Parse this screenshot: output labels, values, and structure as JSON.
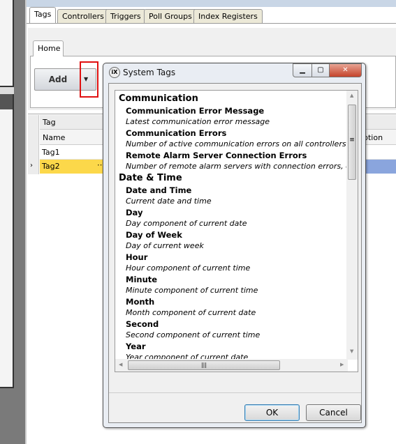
{
  "main_tabs": [
    {
      "label": "Tags",
      "active": true
    },
    {
      "label": "Controllers"
    },
    {
      "label": "Triggers"
    },
    {
      "label": "Poll Groups"
    },
    {
      "label": "Index Registers"
    }
  ],
  "ribbon": {
    "tab": "Home",
    "add_label": "Add",
    "add_dropdown_icon": "caret-down",
    "highlight_color": "#e01010"
  },
  "grid": {
    "group_header": "Tag",
    "column_name": "Name",
    "column_description_partial": "ption",
    "rows": [
      "Tag1",
      "Tag2"
    ],
    "selected_row": "Tag2",
    "selected_color": "#fcd84a"
  },
  "dialog": {
    "title": "System Tags",
    "icon": "iX",
    "categories": [
      {
        "name": "Communication",
        "items": [
          {
            "name": "Communication Error Message",
            "desc": "Latest communication error message"
          },
          {
            "name": "Communication Errors",
            "desc": "Number of active communication errors on all controllers"
          },
          {
            "name": "Remote Alarm Server Connection Errors",
            "desc": "Number of remote alarm servers with connection errors, e.g. d"
          }
        ]
      },
      {
        "name": "Date & Time",
        "items": [
          {
            "name": "Date and Time",
            "desc": "Current date and time"
          },
          {
            "name": "Day",
            "desc": "Day component of current date"
          },
          {
            "name": "Day of Week",
            "desc": "Day of current week"
          },
          {
            "name": "Hour",
            "desc": "Hour component of current time"
          },
          {
            "name": "Minute",
            "desc": "Minute component of current time"
          },
          {
            "name": "Month",
            "desc": "Month component of current date"
          },
          {
            "name": "Second",
            "desc": "Second component of current time"
          },
          {
            "name": "Year",
            "desc": "Year component of current date"
          }
        ]
      }
    ],
    "ok_label": "OK",
    "cancel_label": "Cancel"
  }
}
